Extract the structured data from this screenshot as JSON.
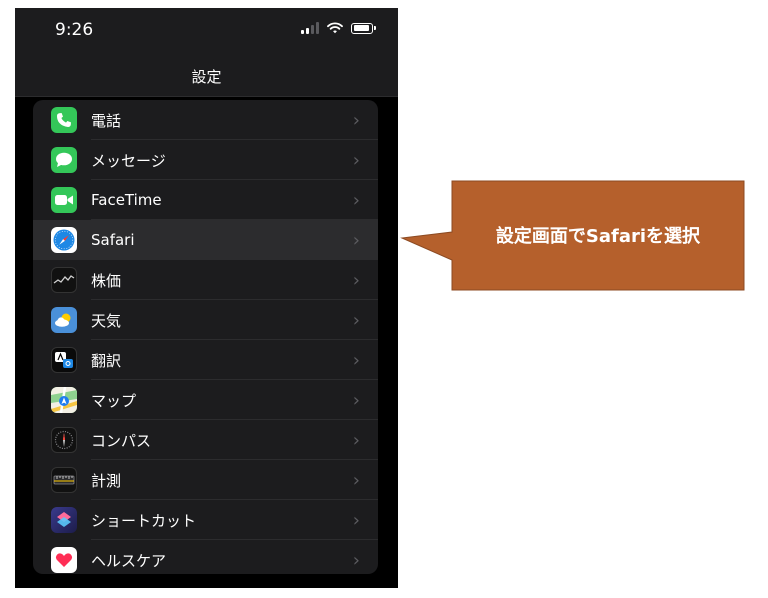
{
  "status_bar": {
    "time": "9:26"
  },
  "nav": {
    "title": "設定"
  },
  "settings": [
    {
      "label": "電話",
      "icon": "phone-icon",
      "color": "#34c759"
    },
    {
      "label": "メッセージ",
      "icon": "messages-icon",
      "color": "#34c759"
    },
    {
      "label": "FaceTime",
      "icon": "facetime-icon",
      "color": "#34c759"
    },
    {
      "label": "Safari",
      "icon": "safari-icon",
      "color": "#1e88e5"
    },
    {
      "label": "株価",
      "icon": "stocks-icon",
      "color": "#111111"
    },
    {
      "label": "天気",
      "icon": "weather-icon",
      "color": "#4a90d9"
    },
    {
      "label": "翻訳",
      "icon": "translate-icon",
      "color": "#0a0a0a"
    },
    {
      "label": "マップ",
      "icon": "maps-icon",
      "color": "#6ac46b"
    },
    {
      "label": "コンパス",
      "icon": "compass-icon",
      "color": "#111111"
    },
    {
      "label": "計測",
      "icon": "measure-icon",
      "color": "#111111"
    },
    {
      "label": "ショートカット",
      "icon": "shortcuts-icon",
      "color": "#5e5ce6"
    },
    {
      "label": "ヘルスケア",
      "icon": "health-icon",
      "color": "#ffffff"
    }
  ],
  "selected_item": "Safari",
  "callout": {
    "text": "設定画面でSafariを選択",
    "color": "#b5602c"
  }
}
